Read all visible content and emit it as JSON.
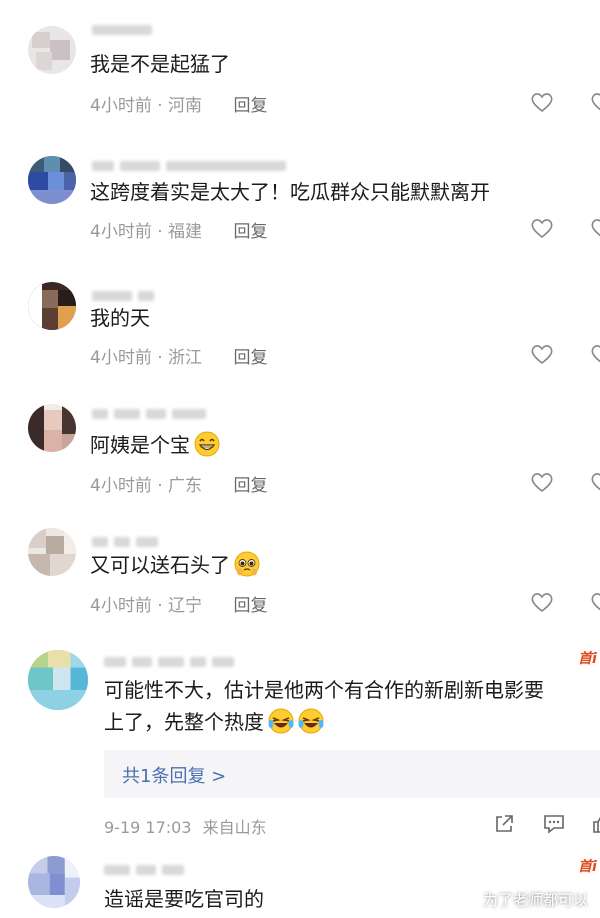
{
  "comments": [
    {
      "text": "我是不是起猛了",
      "time": "4小时前",
      "location": "河南",
      "reply": "回复"
    },
    {
      "text": "这跨度着实是太大了！吃瓜群众只能默默离开",
      "time": "4小时前",
      "location": "福建",
      "reply": "回复"
    },
    {
      "text": "我的天",
      "time": "4小时前",
      "location": "浙江",
      "reply": "回复"
    },
    {
      "text": "阿姨是个宝",
      "time": "4小时前",
      "location": "广东",
      "reply": "回复"
    },
    {
      "text": "又可以送石头了",
      "time": "4小时前",
      "location": "辽宁",
      "reply": "回复"
    }
  ],
  "thread": {
    "badge": "首i",
    "line1": "可能性不大，估计是他两个有合作的新剧新电影要",
    "line2": "上了，先整个热度",
    "replies_link": "共1条回复 >",
    "timestamp": "9-19 17:03",
    "source": "来自山东"
  },
  "last": {
    "badge": "首i",
    "text": "造谣是要吃官司的"
  },
  "separator": " · ",
  "watermark": "为了老师都可以",
  "colors": {
    "meta": "#9a9a9a",
    "link": "#4b6fb0",
    "badge": "#e04a1c"
  }
}
